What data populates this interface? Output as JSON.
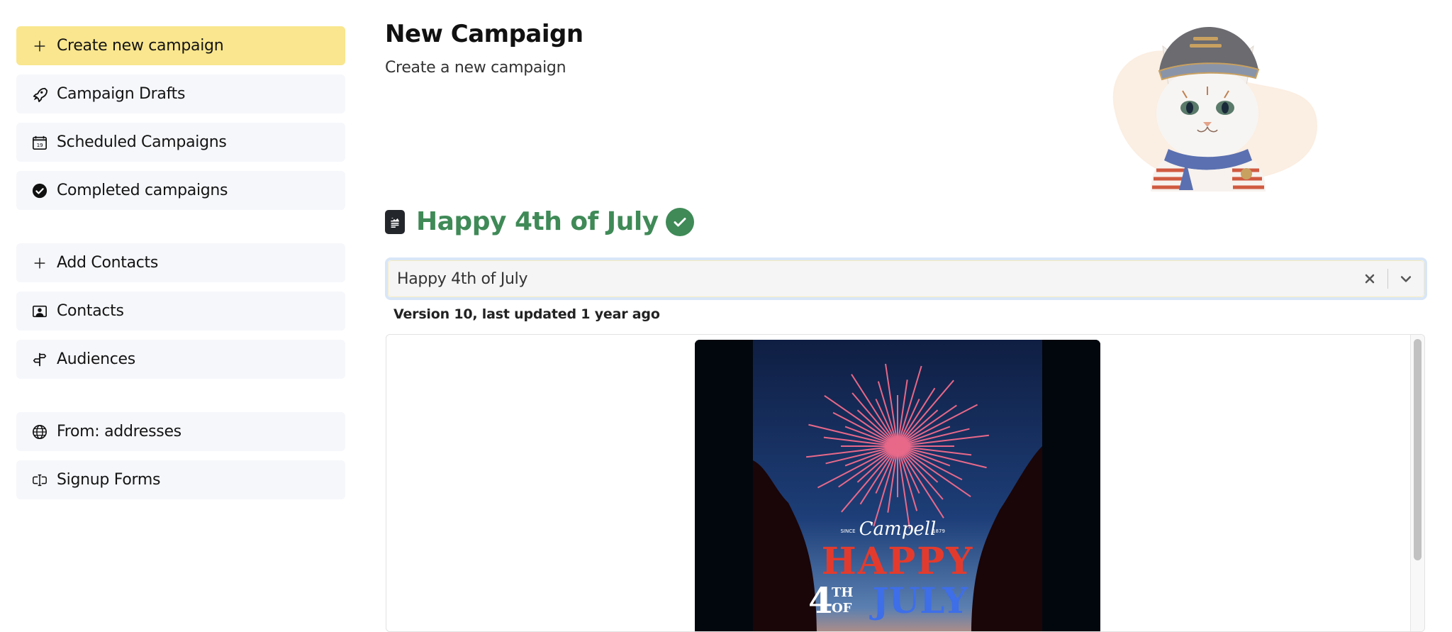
{
  "sidebar": {
    "group1": [
      {
        "label": "Create new campaign",
        "icon": "plus-icon",
        "primary": true
      },
      {
        "label": "Campaign Drafts",
        "icon": "rocket-icon"
      },
      {
        "label": "Scheduled Campaigns",
        "icon": "calendar-icon",
        "icon_text": "19"
      },
      {
        "label": "Completed campaigns",
        "icon": "check-circle-icon"
      }
    ],
    "group2": [
      {
        "label": "Add Contacts",
        "icon": "plus-icon"
      },
      {
        "label": "Contacts",
        "icon": "contact-card-icon"
      },
      {
        "label": "Audiences",
        "icon": "signpost-icon"
      }
    ],
    "group3": [
      {
        "label": "From: addresses",
        "icon": "globe-icon"
      },
      {
        "label": "Signup Forms",
        "icon": "input-cursor-icon"
      }
    ]
  },
  "header": {
    "title": "New Campaign",
    "subtitle": "Create a new campaign",
    "mascot": "cat-mascot-illustration"
  },
  "campaign": {
    "title": "Happy 4th of July",
    "title_icon": "document-image-icon",
    "status_icon": "check-circle-icon",
    "select_value": "Happy 4th of July",
    "version_text": "Version 10, last updated 1 year ago",
    "preview": {
      "brand": "Campell",
      "since_left": "SINCE",
      "since_right": "1879",
      "headline_line1": "HAPPY",
      "headline_num": "4",
      "headline_sup_top": "TH",
      "headline_sup_bottom": "OF",
      "headline_line2": "JULY"
    }
  },
  "colors": {
    "primary_button": "#f9e68e",
    "nav_bg": "#f6f7fb",
    "campaign_green": "#3f8a57",
    "focus_ring": "#d8e6f7",
    "firework_pink": "#ff6f8e",
    "headline_red": "#e23b2e",
    "headline_blue": "#3e6ee8"
  }
}
